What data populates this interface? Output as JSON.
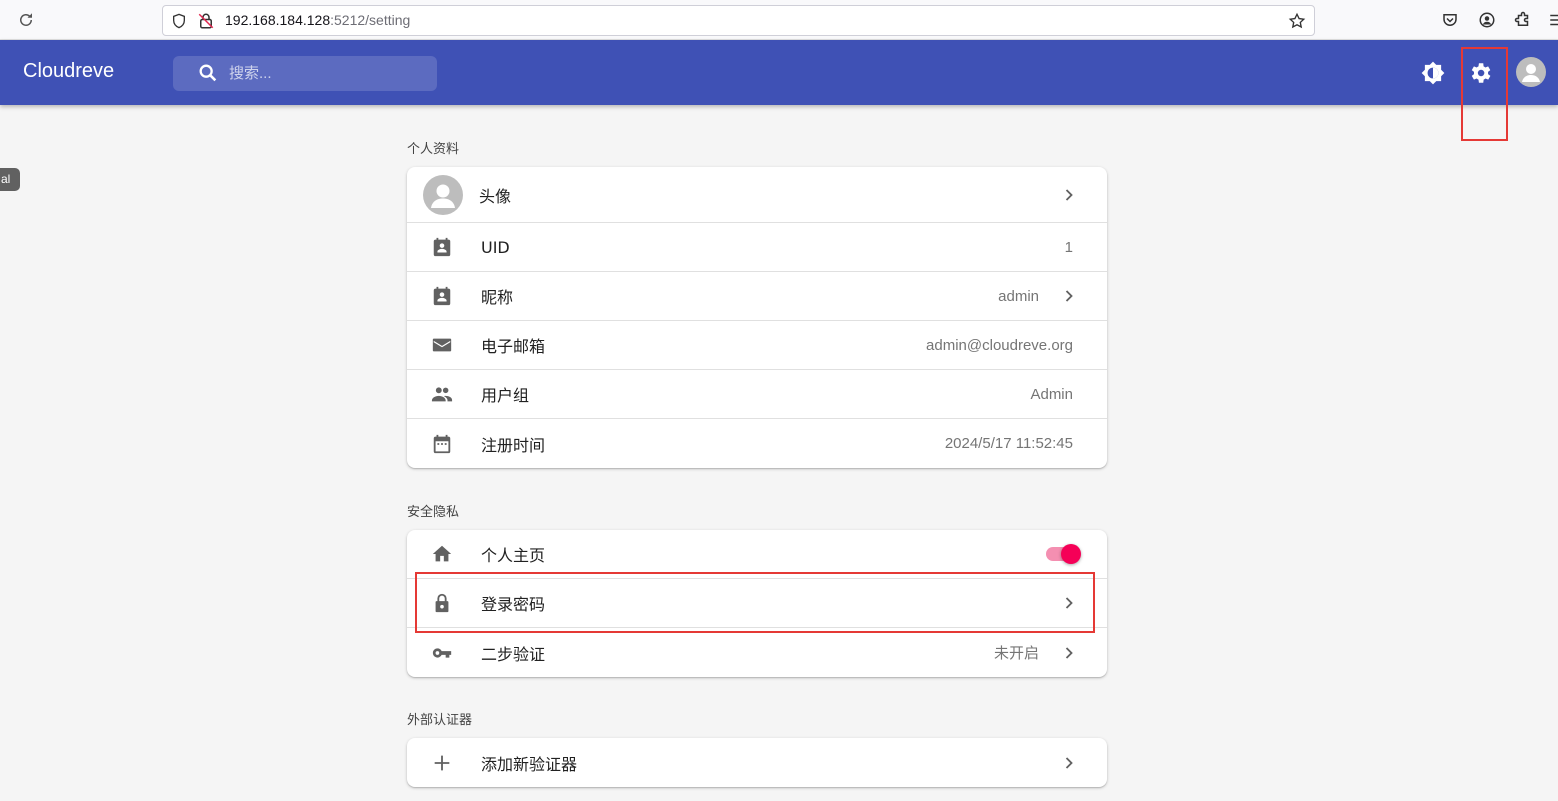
{
  "browser": {
    "url_host": "192.168.184.128",
    "url_path": ":5212/setting"
  },
  "appbar": {
    "title": "Cloudreve",
    "search_placeholder": "搜索..."
  },
  "side_chip": "al",
  "sections": {
    "profile": {
      "title": "个人资料",
      "avatar_label": "头像",
      "uid_label": "UID",
      "uid_value": "1",
      "nickname_label": "昵称",
      "nickname_value": "admin",
      "email_label": "电子邮箱",
      "email_value": "admin@cloudreve.org",
      "group_label": "用户组",
      "group_value": "Admin",
      "registered_label": "注册时间",
      "registered_value": "2024/5/17 11:52:45"
    },
    "security": {
      "title": "安全隐私",
      "homepage_label": "个人主页",
      "homepage_enabled": true,
      "password_label": "登录密码",
      "twofa_label": "二步验证",
      "twofa_value": "未开启"
    },
    "authenticators": {
      "title": "外部认证器",
      "add_label": "添加新验证器"
    }
  },
  "colors": {
    "primary": "#3f51b5",
    "accent": "#f50057",
    "highlight": "#e53935"
  }
}
